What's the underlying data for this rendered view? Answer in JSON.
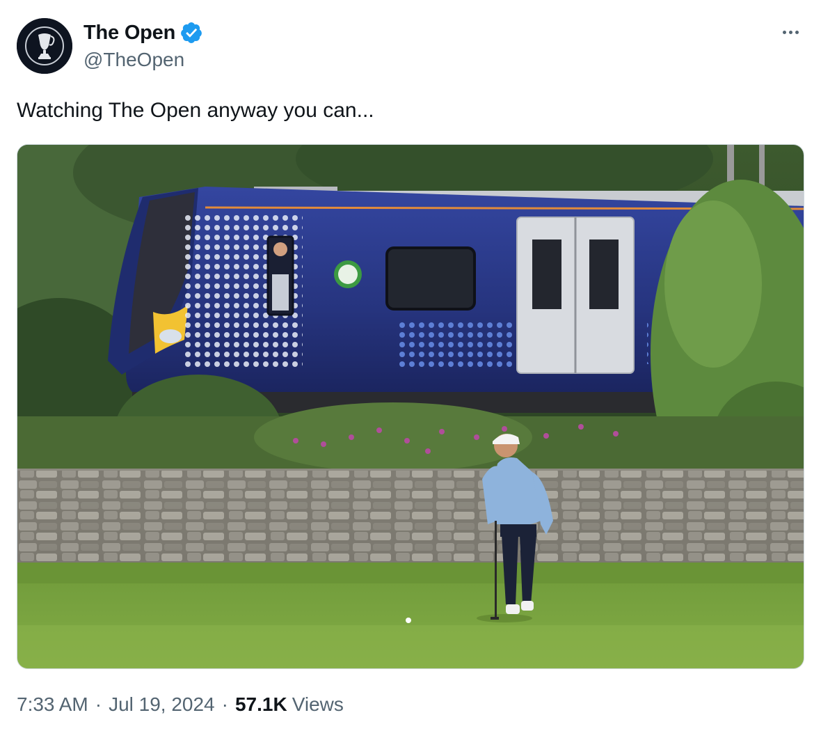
{
  "tweet": {
    "author": {
      "display_name": "The Open",
      "handle": "@TheOpen",
      "verified": true,
      "avatar_icon": "claret-jug-trophy-icon"
    },
    "text": "Watching The Open anyway you can...",
    "media": {
      "type": "photo"
    },
    "meta": {
      "time": "7:33 AM",
      "separator": "·",
      "date": "Jul 19, 2024",
      "views_count": "57.1K",
      "views_label": "Views"
    },
    "more_icon": "more-horizontal-icon"
  },
  "colors": {
    "primary_text": "#0f1419",
    "secondary_text": "#536471",
    "verified_blue": "#1d9bf0",
    "avatar_bg": "#0e1420",
    "train_blue": "#2b3a8c"
  }
}
